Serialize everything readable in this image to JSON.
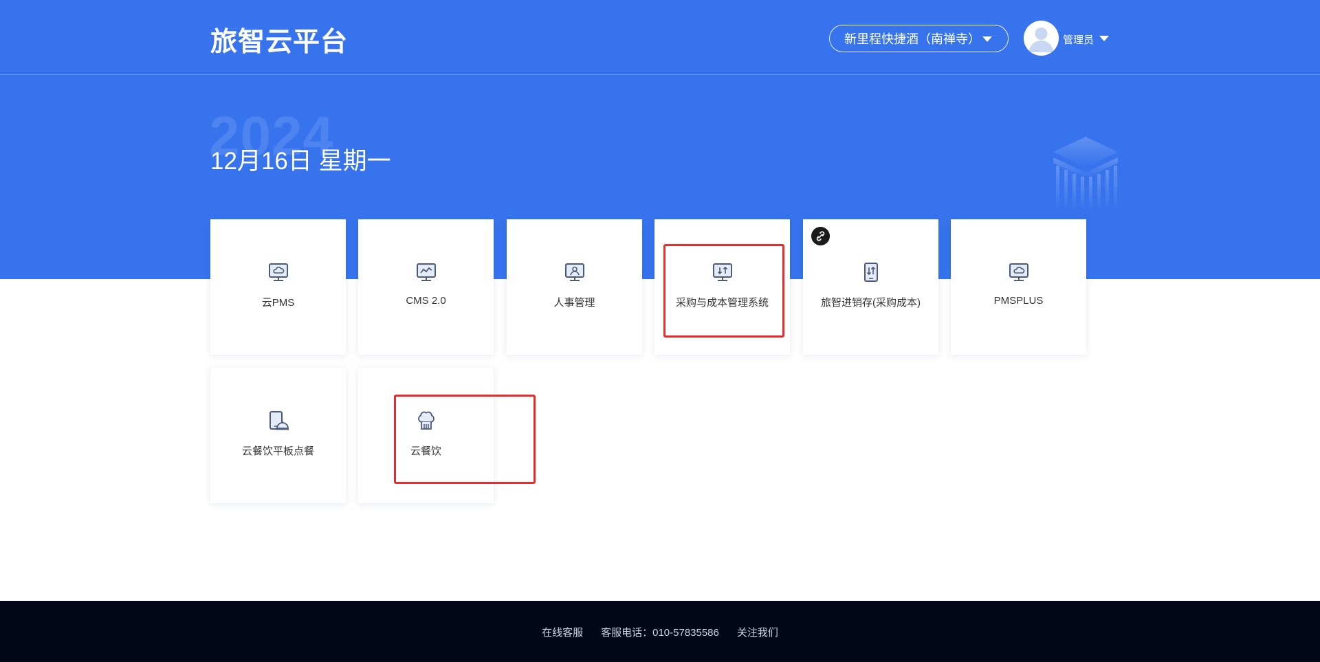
{
  "header": {
    "brand": "旅智云平台",
    "hotel_selector": "新里程快捷酒（南禅寺）",
    "user_name": "管理员"
  },
  "hero": {
    "year": "2024",
    "date": "12月16日 星期一"
  },
  "apps": [
    {
      "label": "云PMS",
      "icon": "monitor-cloud-icon"
    },
    {
      "label": "CMS 2.0",
      "icon": "monitor-chart-icon"
    },
    {
      "label": "人事管理",
      "icon": "monitor-person-icon"
    },
    {
      "label": "采购与成本管理系统",
      "icon": "monitor-transfer-icon"
    },
    {
      "label": "旅智进销存(采购成本)",
      "icon": "tablet-transfer-icon",
      "badge": "link-icon"
    },
    {
      "label": "PMSPLUS",
      "icon": "monitor-cloud-icon"
    },
    {
      "label": "云餐饮平板点餐",
      "icon": "tablet-cloche-icon"
    },
    {
      "label": "云餐饮",
      "icon": "chef-hat-icon"
    }
  ],
  "footer": {
    "links": [
      "在线客服",
      "客服电话：010-57835586",
      "关注我们"
    ]
  },
  "colors": {
    "primary": "#3673ed",
    "footer_bg": "#020618",
    "icon": "#4b5a7a",
    "highlight": "#ea2b2b"
  }
}
